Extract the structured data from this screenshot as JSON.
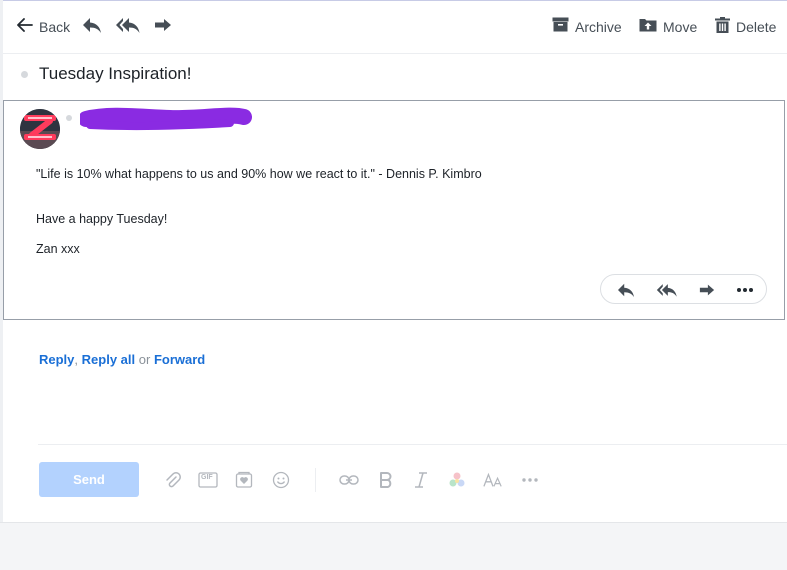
{
  "toolbar": {
    "back_label": "Back",
    "archive_label": "Archive",
    "move_label": "Move",
    "delete_label": "Delete"
  },
  "message": {
    "subject": "Tuesday Inspiration!",
    "sender_redacted": true,
    "body": [
      "\"Life is 10% what happens to us and 90% how we react to it.\" - Dennis P. Kimbro",
      "Have a happy Tuesday!",
      "Zan xxx"
    ]
  },
  "quick_reply": {
    "reply": "Reply",
    "comma": ",",
    "reply_all": "Reply all",
    "or": "or",
    "forward": "Forward"
  },
  "compose": {
    "send_label": "Send",
    "gif_label": "GIF"
  },
  "colors": {
    "link": "#1a6fd6",
    "send_disabled": "#b3d2fe",
    "redaction": "#8a2be2"
  }
}
